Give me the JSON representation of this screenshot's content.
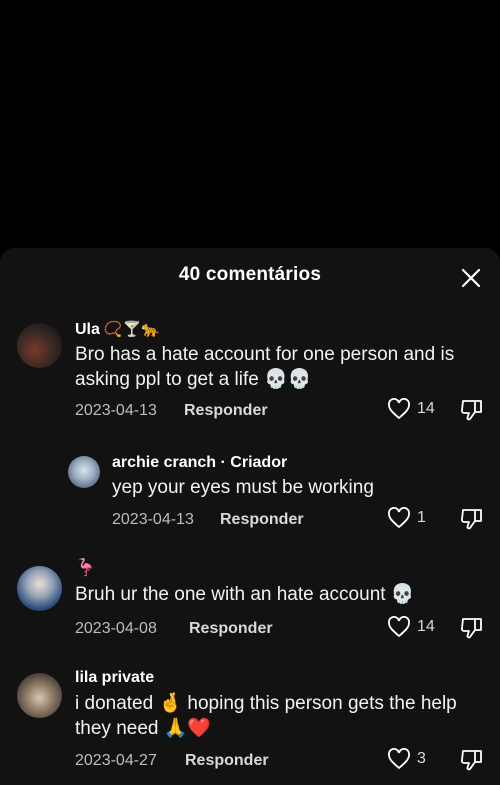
{
  "sheet": {
    "title": "40 comentários"
  },
  "comments": [
    {
      "username": "Ula",
      "emoji_suffix": "📿🍸🐆",
      "text": "Bro has a hate account for one person and is asking ppl to get a life 💀💀",
      "date": "2023-04-13",
      "reply_label": "Responder",
      "likes": "14"
    },
    {
      "username": "archie cranch",
      "creator_badge": "· Criador",
      "text": "yep your eyes must be working",
      "date": "2023-04-13",
      "reply_label": "Responder",
      "likes": "1"
    },
    {
      "username": "🦩",
      "text": "Bruh ur the one with an hate account 💀",
      "date": "2023-04-08",
      "reply_label": "Responder",
      "likes": "14"
    },
    {
      "username": "lila private",
      "text": "i donated 🤞 hoping this person gets the help they need 🙏❤️",
      "date": "2023-04-27",
      "reply_label": "Responder",
      "likes": "3"
    }
  ],
  "icons": {
    "close": "close-icon",
    "like": "heart-outline-icon",
    "dislike": "thumbs-down-icon"
  }
}
